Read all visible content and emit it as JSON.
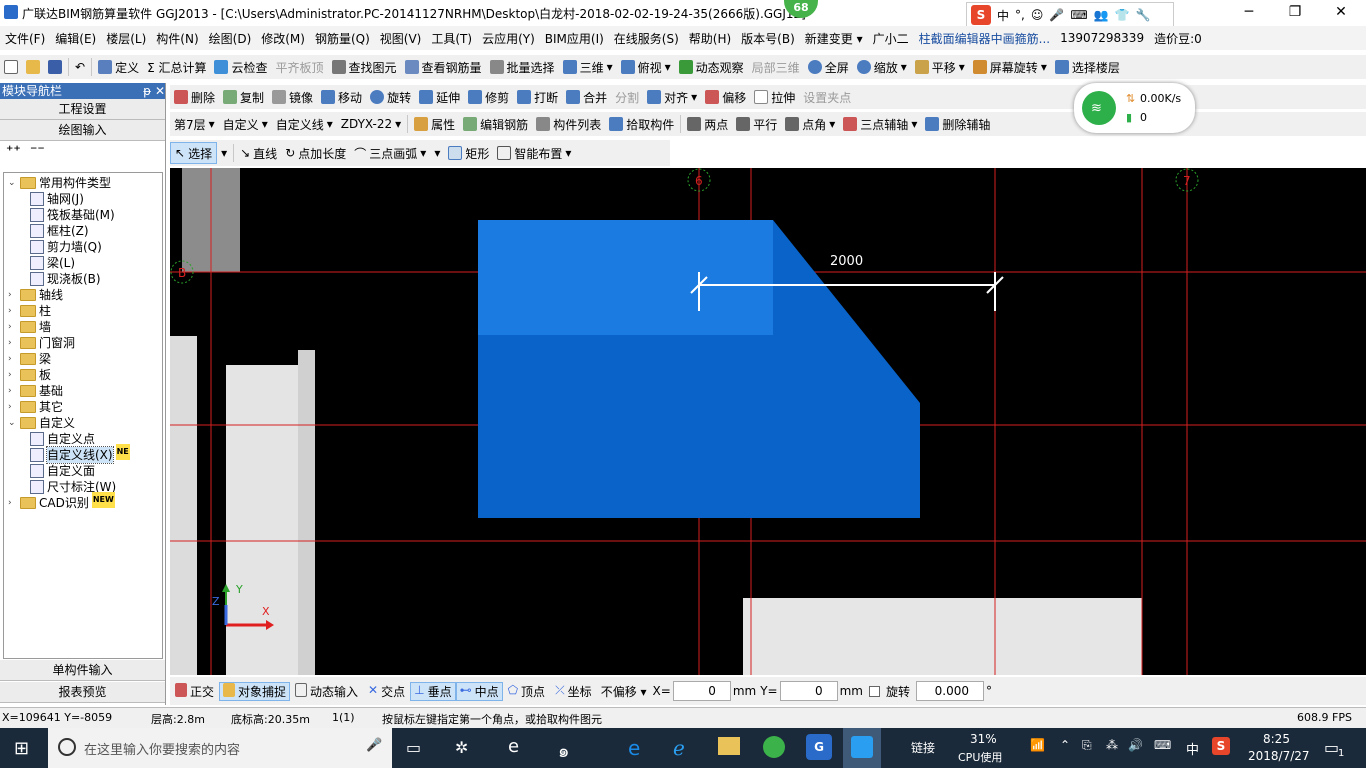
{
  "title": "广联达BIM钢筋算量软件 GGJ2013 - [C:\\Users\\Administrator.PC-20141127NRHM\\Desktop\\白龙村-2018-02-02-19-24-35(2666版).GGJ12]",
  "badge": "68",
  "ime": {
    "cn": "中"
  },
  "menu": [
    "文件(F)",
    "编辑(E)",
    "楼层(L)",
    "构件(N)",
    "绘图(D)",
    "修改(M)",
    "钢筋量(Q)",
    "视图(V)",
    "工具(T)",
    "云应用(Y)",
    "BIM应用(I)",
    "在线服务(S)",
    "帮助(H)",
    "版本号(B)",
    "新建变更 ▾",
    "广小二",
    "柱截面编辑器中画箍筋...",
    "13907298339",
    "造价豆:0"
  ],
  "toolbar1": [
    "定义",
    "Σ 汇总计算",
    "云检查",
    "平齐板顶",
    "查找图元",
    "查看钢筋量",
    "批量选择",
    "三维",
    "俯视",
    "动态观察",
    "局部三维",
    "全屏",
    "缩放",
    "平移",
    "屏幕旋转",
    "选择楼层"
  ],
  "toolbar2": [
    "删除",
    "复制",
    "镜像",
    "移动",
    "旋转",
    "延伸",
    "修剪",
    "打断",
    "合并",
    "分割",
    "对齐",
    "偏移",
    "拉伸",
    "设置夹点"
  ],
  "toolbar3": {
    "floor": "第7层",
    "type": "自定义",
    "sub": "自定义线",
    "code": "ZDYX-22",
    "items": [
      "属性",
      "编辑钢筋",
      "构件列表",
      "拾取构件",
      "两点",
      "平行",
      "点角",
      "三点辅轴",
      "删除辅轴"
    ]
  },
  "toolbar4": [
    "选择",
    "直线",
    "点加长度",
    "三点画弧",
    "矩形",
    "智能布置"
  ],
  "nav": {
    "title": "模块导航栏",
    "pin": "ᵽ ✕",
    "btn1": "工程设置",
    "btn2": "绘图输入",
    "btn3": "单构件输入",
    "btn4": "报表预览",
    "tree": [
      {
        "label": "常用构件类型",
        "level": 0,
        "folder": true,
        "open": true
      },
      {
        "label": "轴网(J)",
        "level": 1
      },
      {
        "label": "筏板基础(M)",
        "level": 1
      },
      {
        "label": "框柱(Z)",
        "level": 1
      },
      {
        "label": "剪力墙(Q)",
        "level": 1
      },
      {
        "label": "梁(L)",
        "level": 1
      },
      {
        "label": "现浇板(B)",
        "level": 1
      },
      {
        "label": "轴线",
        "level": 0,
        "folder": true
      },
      {
        "label": "柱",
        "level": 0,
        "folder": true
      },
      {
        "label": "墙",
        "level": 0,
        "folder": true
      },
      {
        "label": "门窗洞",
        "level": 0,
        "folder": true
      },
      {
        "label": "梁",
        "level": 0,
        "folder": true
      },
      {
        "label": "板",
        "level": 0,
        "folder": true
      },
      {
        "label": "基础",
        "level": 0,
        "folder": true
      },
      {
        "label": "其它",
        "level": 0,
        "folder": true
      },
      {
        "label": "自定义",
        "level": 0,
        "folder": true,
        "open": true
      },
      {
        "label": "自定义点",
        "level": 1
      },
      {
        "label": "自定义线(X)",
        "level": 1,
        "tag": "NE"
      },
      {
        "label": "自定义面",
        "level": 1
      },
      {
        "label": "尺寸标注(W)",
        "level": 1
      },
      {
        "label": "CAD识别",
        "level": 0,
        "folder": true,
        "tag": "NEW"
      }
    ]
  },
  "canvas": {
    "dim_label": "2000",
    "axis_6": "6",
    "axis_7": "7",
    "axis_b": "B",
    "x_axis": "X",
    "y_axis": "Y",
    "z_axis": "Z"
  },
  "snapbar": {
    "items": [
      "正交",
      "对象捕捉",
      "动态输入",
      "交点",
      "垂点",
      "中点",
      "顶点",
      "坐标"
    ],
    "offset": "不偏移",
    "x_label": "X=",
    "x_val": "0",
    "y_label": "Y=",
    "y_val": "0",
    "unit": "mm",
    "rotate_label": "旋转",
    "rotate_val": "0.000",
    "deg": "°"
  },
  "status": {
    "coords": "X=109641 Y=-8059",
    "floor_h": "层高:2.8m",
    "base_h": "底标高:20.35m",
    "count": "1(1)",
    "hint": "按鼠标左键指定第一个角点，或拾取构件图元",
    "fps": "608.9 FPS"
  },
  "wifi": {
    "speed": "0.00K/s",
    "count": "0"
  },
  "taskbar": {
    "search": "在这里输入你要搜索的内容",
    "link": "链接",
    "cpu": "31%",
    "cpu_label": "CPU使用",
    "ime": "中",
    "time": "8:25",
    "date": "2018/7/27",
    "notif": "1"
  }
}
